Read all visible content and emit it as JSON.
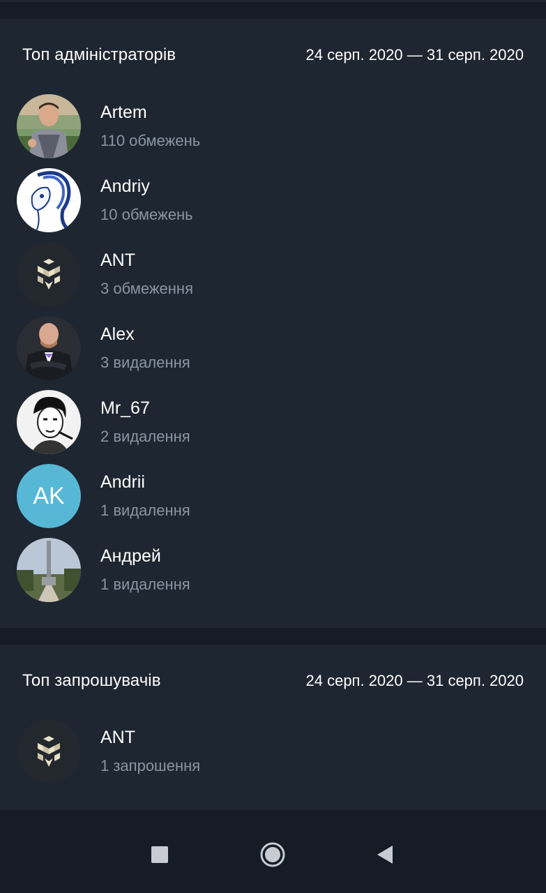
{
  "admins": {
    "title": "Топ адміністраторів",
    "range": "24 серп. 2020 — 31 серп. 2020",
    "items": [
      {
        "name": "Artem",
        "detail": "110 обмежень",
        "avatar": "photo-man-armor"
      },
      {
        "name": "Andriy",
        "detail": "10 обмежень",
        "avatar": "drawing-pony"
      },
      {
        "name": "ANT",
        "detail": "3 обмеження",
        "avatar": "cube-logo"
      },
      {
        "name": "Alex",
        "detail": "3 видалення",
        "avatar": "photo-man-suit"
      },
      {
        "name": "Mr_67",
        "detail": "2 видалення",
        "avatar": "sketch-portrait"
      },
      {
        "name": "Andrii",
        "detail": "1 видалення",
        "avatar": "initials",
        "initials": "AK",
        "avatar_color": "#57b8d6"
      },
      {
        "name": "Андрей",
        "detail": "1 видалення",
        "avatar": "photo-monument"
      }
    ]
  },
  "inviters": {
    "title": "Топ запрошувачів",
    "range": "24 серп. 2020 — 31 серп. 2020",
    "items": [
      {
        "name": "ANT",
        "detail": "1 запрошення",
        "avatar": "cube-logo"
      }
    ]
  },
  "navbar": {
    "icons": [
      "recents-square-icon",
      "home-circle-icon",
      "back-triangle-icon"
    ]
  },
  "colors": {
    "background": "#151c25",
    "card": "#1e2631",
    "secondary_text": "#8a96a3",
    "accent_avatar": "#57b8d6"
  }
}
